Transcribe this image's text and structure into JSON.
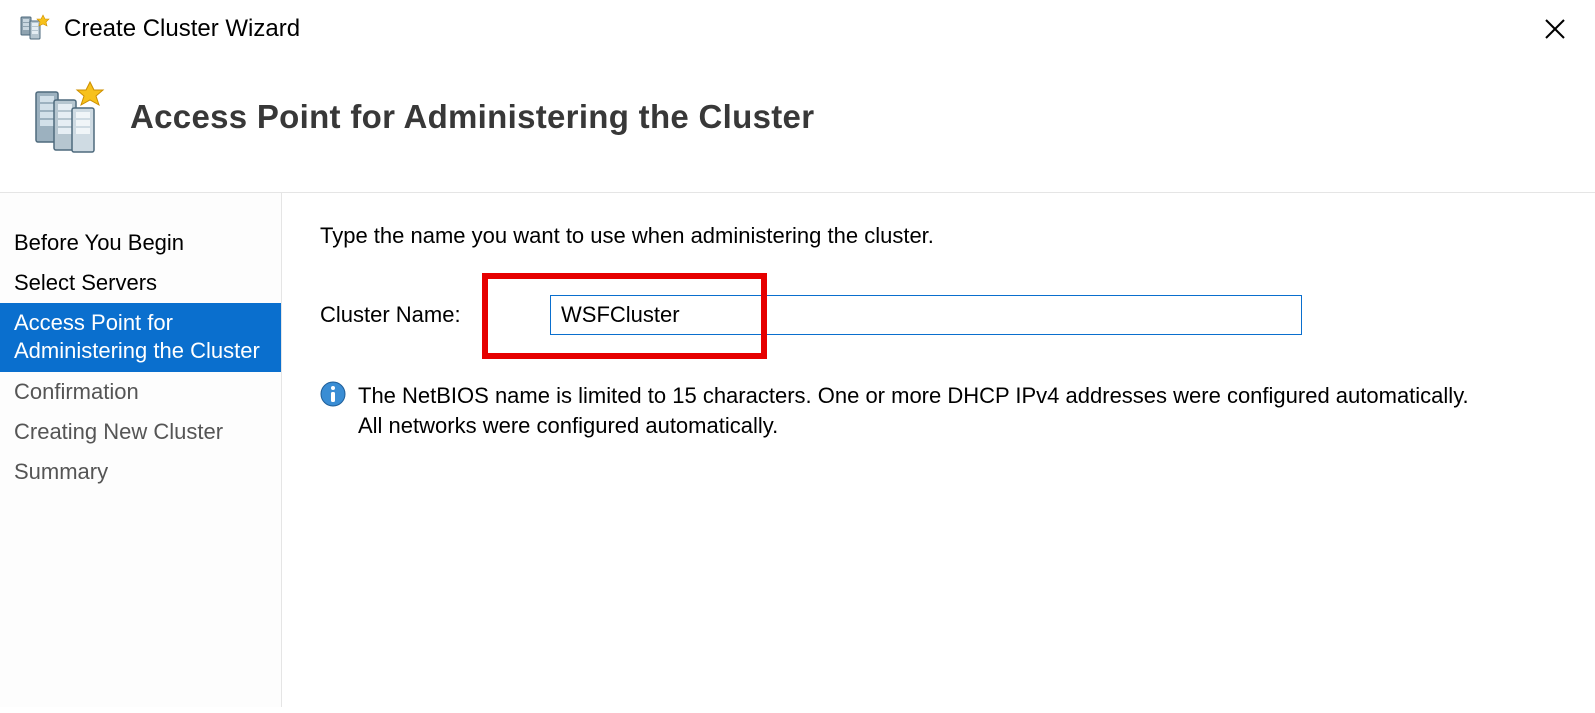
{
  "window": {
    "title": "Create Cluster Wizard"
  },
  "header": {
    "title": "Access Point for Administering the Cluster"
  },
  "sidebar": {
    "steps": [
      {
        "label": "Before You Begin"
      },
      {
        "label": "Select Servers"
      },
      {
        "label": "Access Point for Administering the Cluster"
      },
      {
        "label": "Confirmation"
      },
      {
        "label": "Creating New Cluster"
      },
      {
        "label": "Summary"
      }
    ]
  },
  "main": {
    "instruction": "Type the name you want to use when administering the cluster.",
    "cluster_name_label": "Cluster Name:",
    "cluster_name_value": "WSFCluster",
    "info_text": "The NetBIOS name is limited to 15 characters.  One or more DHCP IPv4 addresses were configured automatically.  All networks were configured automatically."
  },
  "colors": {
    "accent": "#0a6fce",
    "highlight": "#e60000"
  }
}
